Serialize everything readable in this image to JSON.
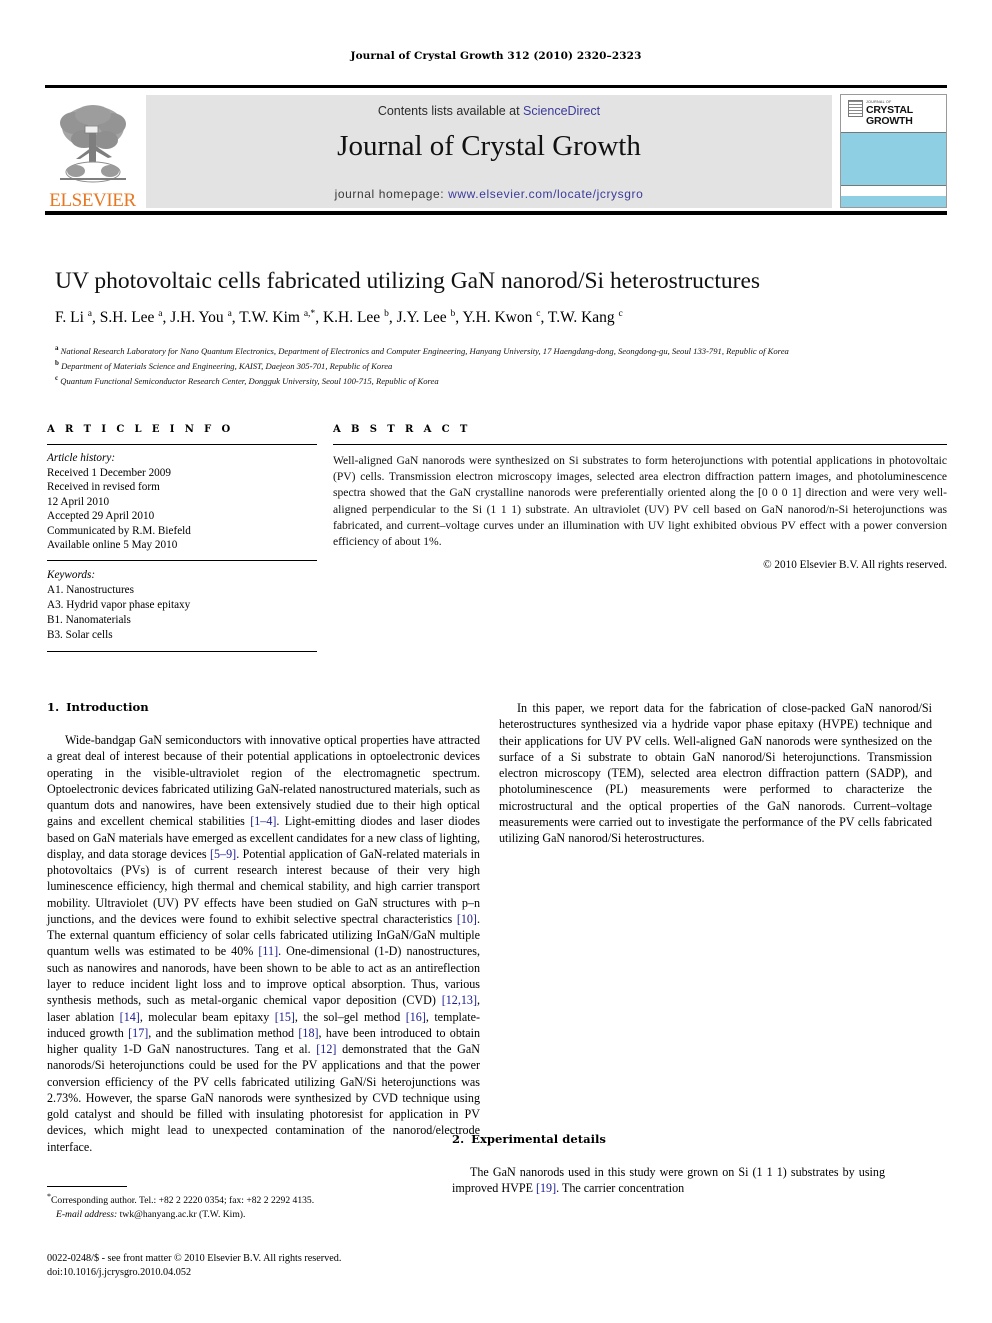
{
  "running_head": "Journal of Crystal Growth 312 (2010) 2320–2323",
  "masthead": {
    "publisher_logo_label": "ELSEVIER",
    "contents_prefix": "Contents lists available at ",
    "contents_link": "ScienceDirect",
    "journal_title": "Journal of Crystal Growth",
    "homepage_prefix": "journal homepage: ",
    "homepage_url": "www.elsevier.com/locate/jcrysgro",
    "cover": {
      "journal_of": "JOURNAL OF",
      "line1": "CRYSTAL",
      "line2": "GROWTH",
      "band_color": "#8ecfe3"
    }
  },
  "article": {
    "title": "UV photovoltaic cells fabricated utilizing GaN nanorod/Si heterostructures",
    "authors_html": "F. Li <sup>a</sup>, S.H. Lee <sup>a</sup>, J.H. You <sup>a</sup>, T.W. Kim <sup>a,*</sup>, K.H. Lee <sup>b</sup>, J.Y. Lee <sup>b</sup>, Y.H. Kwon <sup>c</sup>, T.W. Kang <sup>c</sup>",
    "affiliations": [
      "National Research Laboratory for Nano Quantum Electronics, Department of Electronics and Computer Engineering, Hanyang University, 17 Haengdang-dong, Seongdong-gu, Seoul 133-791, Republic of Korea",
      "Department of Materials Science and Engineering, KAIST, Daejeon 305-701, Republic of Korea",
      "Quantum Functional Semiconductor Research Center, Dongguk University, Seoul 100-715, Republic of Korea"
    ],
    "affiliation_marks": [
      "a",
      "b",
      "c"
    ]
  },
  "article_info": {
    "heading": "A R T I C L E   I N F O",
    "history_label": "Article history:",
    "history": [
      "Received 1 December 2009",
      "Received in revised form",
      "12 April 2010",
      "Accepted 29 April 2010",
      "Communicated by R.M. Biefeld",
      "Available online 5 May 2010"
    ],
    "keywords_label": "Keywords:",
    "keywords": [
      "A1. Nanostructures",
      "A3. Hydrid vapor phase epitaxy",
      "B1. Nanomaterials",
      "B3. Solar cells"
    ]
  },
  "abstract": {
    "heading": "A B S T R A C T",
    "text": "Well-aligned GaN nanorods were synthesized on Si substrates to form heterojunctions with potential applications in photovoltaic (PV) cells. Transmission electron microscopy images, selected area electron diffraction pattern images, and photoluminescence spectra showed that the GaN crystalline nanorods were preferentially oriented along the [0 0 0 1] direction and were very well-aligned perpendicular to the Si (1 1 1) substrate. An ultraviolet (UV) PV cell based on GaN nanorod/n-Si heterojunctions was fabricated, and current–voltage curves under an illumination with UV light exhibited obvious PV effect with a power conversion efficiency of about 1%.",
    "copyright": "© 2010 Elsevier B.V. All rights reserved."
  },
  "sections": {
    "intro": {
      "number": "1.",
      "title": "Introduction",
      "paragraph1_html": "Wide-bandgap GaN semiconductors with innovative optical properties have attracted a great deal of interest because of their potential applications in optoelectronic devices operating in the visible-ultraviolet region of the electromagnetic spectrum. Optoelectronic devices fabricated utilizing GaN-related nanostructured materials, such as quantum dots and nanowires, have been extensively studied due to their high optical gains and excellent chemical stabilities <span class=\"ref\">[1–4]</span>. Light-emitting diodes and laser diodes based on GaN materials have emerged as excellent candidates for a new class of lighting, display, and data storage devices <span class=\"ref\">[5–9]</span>. Potential application of GaN-related materials in photovoltaics (PVs) is of current research interest because of their very high luminescence efficiency, high thermal and chemical stability, and high carrier transport mobility. Ultraviolet (UV) PV effects have been studied on GaN structures with p–n junctions, and the devices were found to exhibit selective spectral characteristics <span class=\"ref\">[10]</span>. The external quantum efficiency of solar cells fabricated utilizing InGaN/GaN multiple quantum wells was estimated to be 40% <span class=\"ref\">[11]</span>. One-dimensional (1-D) nanostructures, such as nanowires and nanorods, have been shown to be able to act as an antireflection layer to reduce incident light loss and to improve optical absorption. Thus, various synthesis methods, such as metal-organic chemical vapor deposition (CVD) <span class=\"ref\">[12,13]</span>, laser ablation <span class=\"ref\">[14]</span>, molecular beam epitaxy <span class=\"ref\">[15]</span>, the sol–gel method <span class=\"ref\">[16]</span>, template-induced growth <span class=\"ref\">[17]</span>, and the sublimation method <span class=\"ref\">[18]</span>, have been introduced to obtain higher quality 1-D GaN nanostructures. Tang et al. <span class=\"ref\">[12]</span> demonstrated that the GaN nanorods/Si heterojunctions could be used for the PV applications and that the power conversion efficiency of the PV cells fabricated utilizing GaN/Si heterojunctions was 2.73%. However, the sparse GaN nanorods were synthesized by CVD technique using gold catalyst and should be filled with insulating photoresist for application in PV devices, which might lead to unexpected contamination of the nanorod/electrode interface.",
      "paragraph2_html": "In this paper, we report data for the fabrication of close-packed GaN nanorod/Si heterostructures synthesized via a hydride vapor phase epitaxy (HVPE) technique and their applications for UV PV cells. Well-aligned GaN nanorods were synthesized on the surface of a Si substrate to obtain GaN nanorod/Si heterojunctions. Transmission electron microscopy (TEM), selected area electron diffraction pattern (SADP), and photoluminescence (PL) measurements were performed to characterize the microstructural and the optical properties of the GaN nanorods. Current–voltage measurements were carried out to investigate the performance of the PV cells fabricated utilizing GaN nanorod/Si heterostructures."
    },
    "experimental": {
      "number": "2.",
      "title": "Experimental details",
      "paragraph1_html": "The GaN nanorods used in this study were grown on Si (1 1 1) substrates by using improved HVPE <span class=\"ref\">[19]</span>. The carrier concentration"
    }
  },
  "footnote": {
    "corresponding_html": "<span class=\"star\">*</span>Corresponding author. Tel.: +82 2 2220 0354; fax: +82 2 2292 4135.",
    "email_html": "<span class=\"ital\">E-mail address:</span> twk@hanyang.ac.kr (T.W. Kim)."
  },
  "imprint": {
    "line1": "0022-0248/$ - see front matter © 2010 Elsevier B.V. All rights reserved.",
    "line2": "doi:10.1016/j.jcrysgro.2010.04.052"
  }
}
